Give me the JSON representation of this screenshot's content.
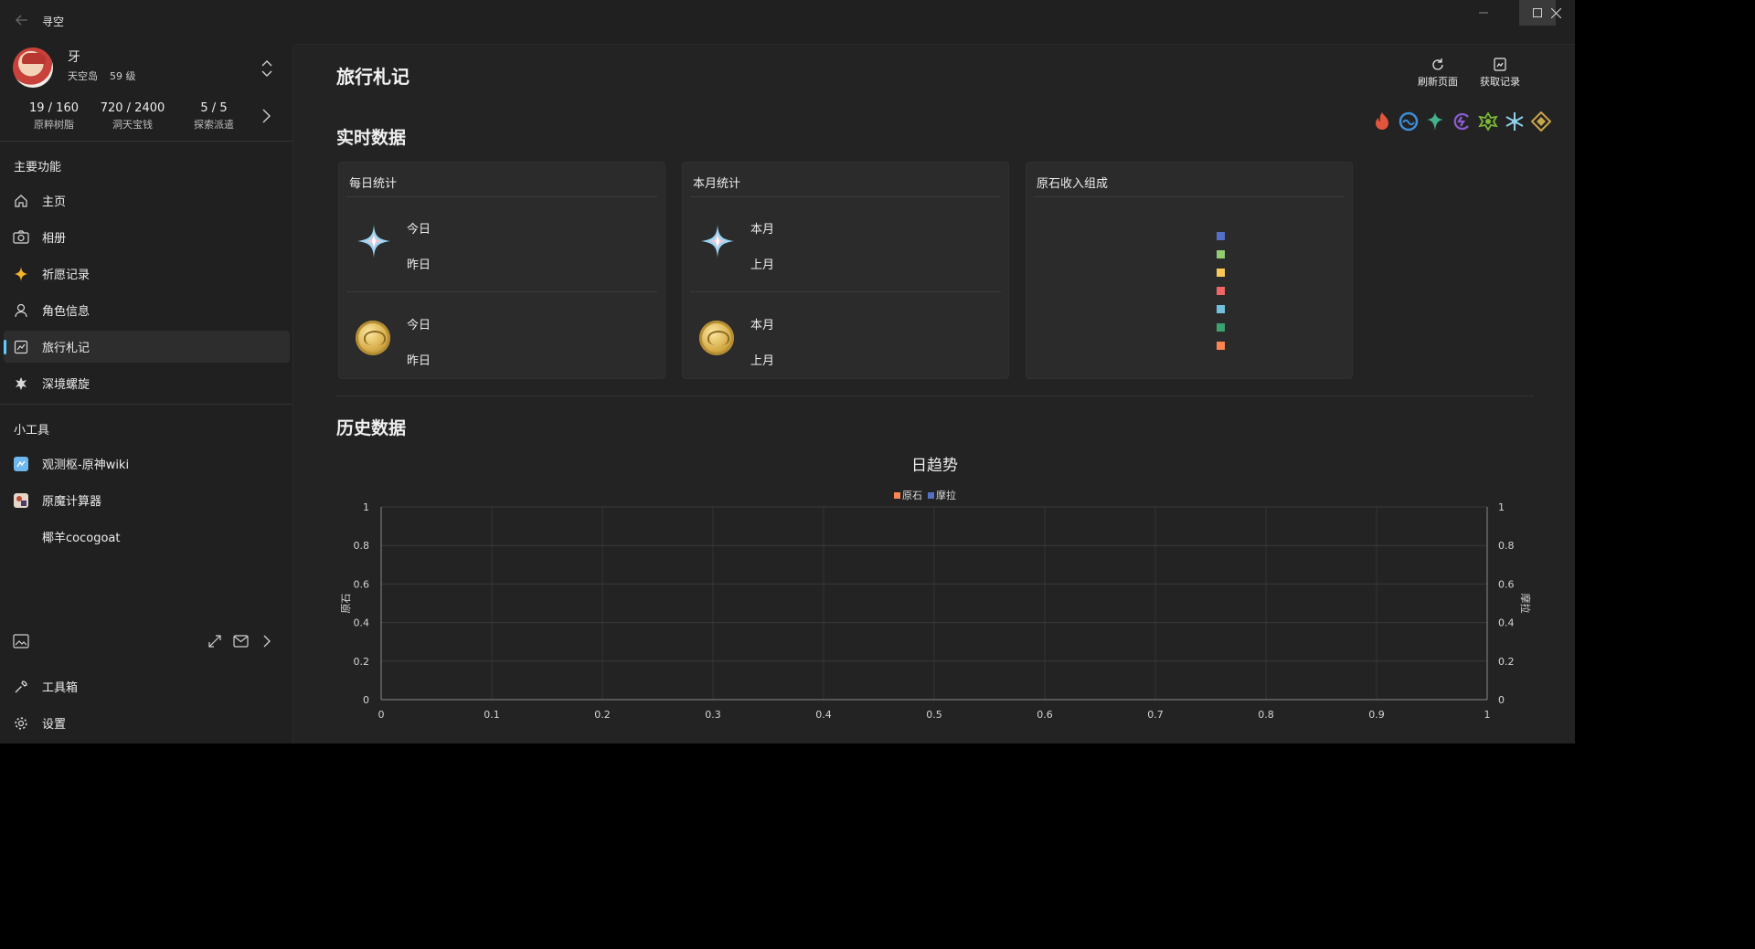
{
  "app": {
    "title": "寻空"
  },
  "user": {
    "name": "牙",
    "server": "天空岛",
    "level": "59 级"
  },
  "stats": [
    {
      "value": "19 / 160",
      "label": "原粹树脂"
    },
    {
      "value": "720 / 2400",
      "label": "洞天宝钱"
    },
    {
      "value": "5 / 5",
      "label": "探索派遣"
    }
  ],
  "sidebar": {
    "main_section": "主要功能",
    "items": [
      {
        "label": "主页",
        "icon": "home-icon"
      },
      {
        "label": "相册",
        "icon": "camera-icon"
      },
      {
        "label": "祈愿记录",
        "icon": "sparkle-icon"
      },
      {
        "label": "角色信息",
        "icon": "person-icon"
      },
      {
        "label": "旅行札记",
        "icon": "notebook-icon",
        "active": true
      },
      {
        "label": "深境螺旋",
        "icon": "abyss-icon"
      }
    ],
    "tools_section": "小工具",
    "tools": [
      {
        "label": "观测枢-原神wiki"
      },
      {
        "label": "原魔计算器"
      },
      {
        "label": "椰羊cocogoat"
      }
    ],
    "footer": {
      "toolbox": "工具箱",
      "settings": "设置"
    }
  },
  "page": {
    "title": "旅行札记",
    "refresh": "刷新页面",
    "fetch": "获取记录",
    "realtime": "实时数据",
    "history": "历史数据"
  },
  "elements": [
    {
      "name": "pyro",
      "color": "#e2553c"
    },
    {
      "name": "hydro",
      "color": "#3e8ed8"
    },
    {
      "name": "anemo",
      "color": "#45b08c"
    },
    {
      "name": "electro",
      "color": "#8a5ad0"
    },
    {
      "name": "dendro",
      "color": "#7ab835"
    },
    {
      "name": "cryo",
      "color": "#8fd0e8"
    },
    {
      "name": "geo",
      "color": "#c9a54a"
    }
  ],
  "cards": {
    "daily": {
      "title": "每日统计",
      "today": "今日",
      "yesterday": "昨日",
      "today2": "今日",
      "yesterday2": "昨日"
    },
    "monthly": {
      "title": "本月统计",
      "this": "本月",
      "last": "上月",
      "this2": "本月",
      "last2": "上月"
    },
    "income": {
      "title": "原石收入组成",
      "colors": [
        "#5470c6",
        "#91cc75",
        "#fac858",
        "#ee6666",
        "#73c0de",
        "#3ba272",
        "#fc8452"
      ]
    }
  },
  "chart_data": {
    "type": "line",
    "title": "日趋势",
    "x": [
      0,
      0.1,
      0.2,
      0.3,
      0.4,
      0.5,
      0.6,
      0.7,
      0.8,
      0.9,
      1
    ],
    "x_ticks": [
      "0",
      "0.1",
      "0.2",
      "0.3",
      "0.4",
      "0.5",
      "0.6",
      "0.7",
      "0.8",
      "0.9",
      "1"
    ],
    "y_ticks": [
      "0",
      "0.2",
      "0.4",
      "0.6",
      "0.8",
      "1"
    ],
    "xlim": [
      0,
      1
    ],
    "ylim": [
      0,
      1
    ],
    "y2lim": [
      0,
      1
    ],
    "ylabel": "原石",
    "y2label": "摩拉",
    "grid": true,
    "legend": "top-center",
    "series": [
      {
        "name": "原石",
        "color": "#fc8452",
        "values": []
      },
      {
        "name": "摩拉",
        "color": "#5470c6",
        "values": []
      }
    ]
  }
}
